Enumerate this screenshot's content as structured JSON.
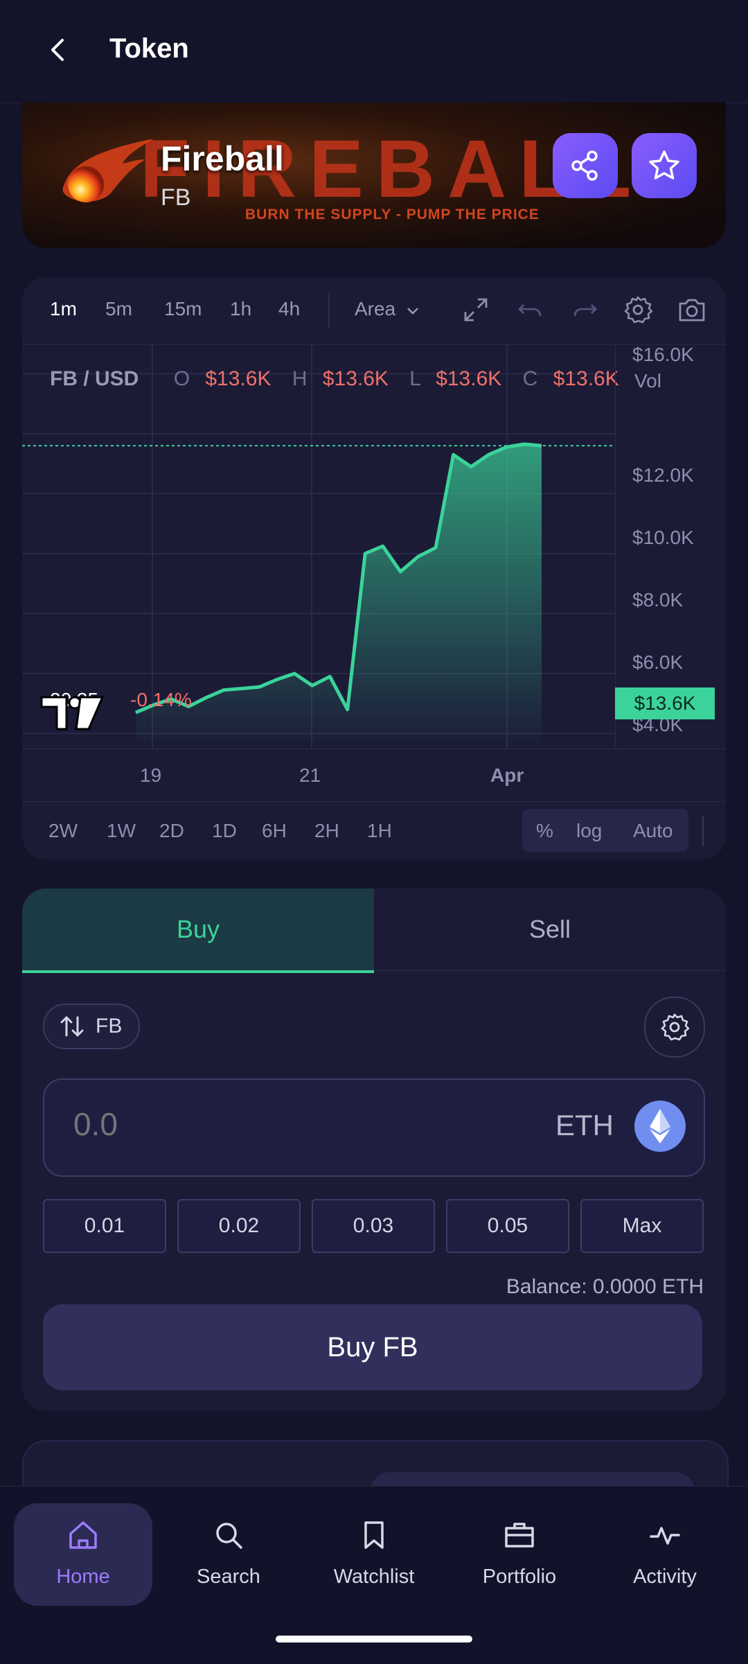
{
  "header": {
    "title": "Token"
  },
  "banner": {
    "word": "FIREBALL",
    "tagline": "BURN THE SUPPLY - PUMP THE PRICE",
    "token_name": "Fireball",
    "token_symbol": "FB"
  },
  "chart": {
    "timeframes": [
      "1m",
      "5m",
      "15m",
      "1h",
      "4h"
    ],
    "active_timeframe": "1m",
    "chart_type": "Area",
    "ohlc": {
      "pair": "FB / USD",
      "o_label": "O",
      "o": "$13.6K",
      "h_label": "H",
      "h": "$13.6K",
      "l_label": "L",
      "l": "$13.6K",
      "c_label": "C",
      "c": "$13.6K",
      "vol_label": "Vol"
    },
    "last_value": "20.35",
    "last_change": "-0.14%",
    "price_tag": "$13.6K",
    "y_ticks": [
      "$16.0K",
      "$12.0K",
      "$10.0K",
      "$8.0K",
      "$6.0K",
      "$4.0K"
    ],
    "x_ticks": [
      "19",
      "21",
      "Apr"
    ],
    "ranges": [
      "2W",
      "1W",
      "2D",
      "1D",
      "6H",
      "2H",
      "1H"
    ],
    "scale_options": [
      "%",
      "log",
      "Auto"
    ],
    "colors": {
      "line": "#3bd39a",
      "down": "#f0706a"
    }
  },
  "chart_data": {
    "type": "area",
    "ylim": [
      3500,
      17000
    ],
    "x_tick_labels": [
      "19",
      "21",
      "Apr"
    ],
    "values": [
      4700,
      4950,
      5150,
      4900,
      5200,
      5450,
      5500,
      5550,
      5800,
      6000,
      5600,
      5900,
      4800,
      10000,
      10250,
      9400,
      9900,
      10200,
      13300,
      12900,
      13300,
      13550,
      13650,
      13600
    ],
    "last_price": "$13.6K"
  },
  "trade": {
    "tab_buy": "Buy",
    "tab_sell": "Sell",
    "unit_toggle": "FB",
    "amount_placeholder": "0.0",
    "currency": "ETH",
    "quick_amounts": [
      "0.01",
      "0.02",
      "0.03",
      "0.05",
      "Max"
    ],
    "balance": "Balance: 0.0000 ETH",
    "submit_label": "Buy FB"
  },
  "nav": {
    "items": [
      {
        "label": "Home",
        "icon": "home-icon"
      },
      {
        "label": "Search",
        "icon": "search-icon"
      },
      {
        "label": "Watchlist",
        "icon": "bookmark-icon"
      },
      {
        "label": "Portfolio",
        "icon": "briefcase-icon"
      },
      {
        "label": "Activity",
        "icon": "pulse-icon"
      }
    ],
    "active": "Home"
  }
}
